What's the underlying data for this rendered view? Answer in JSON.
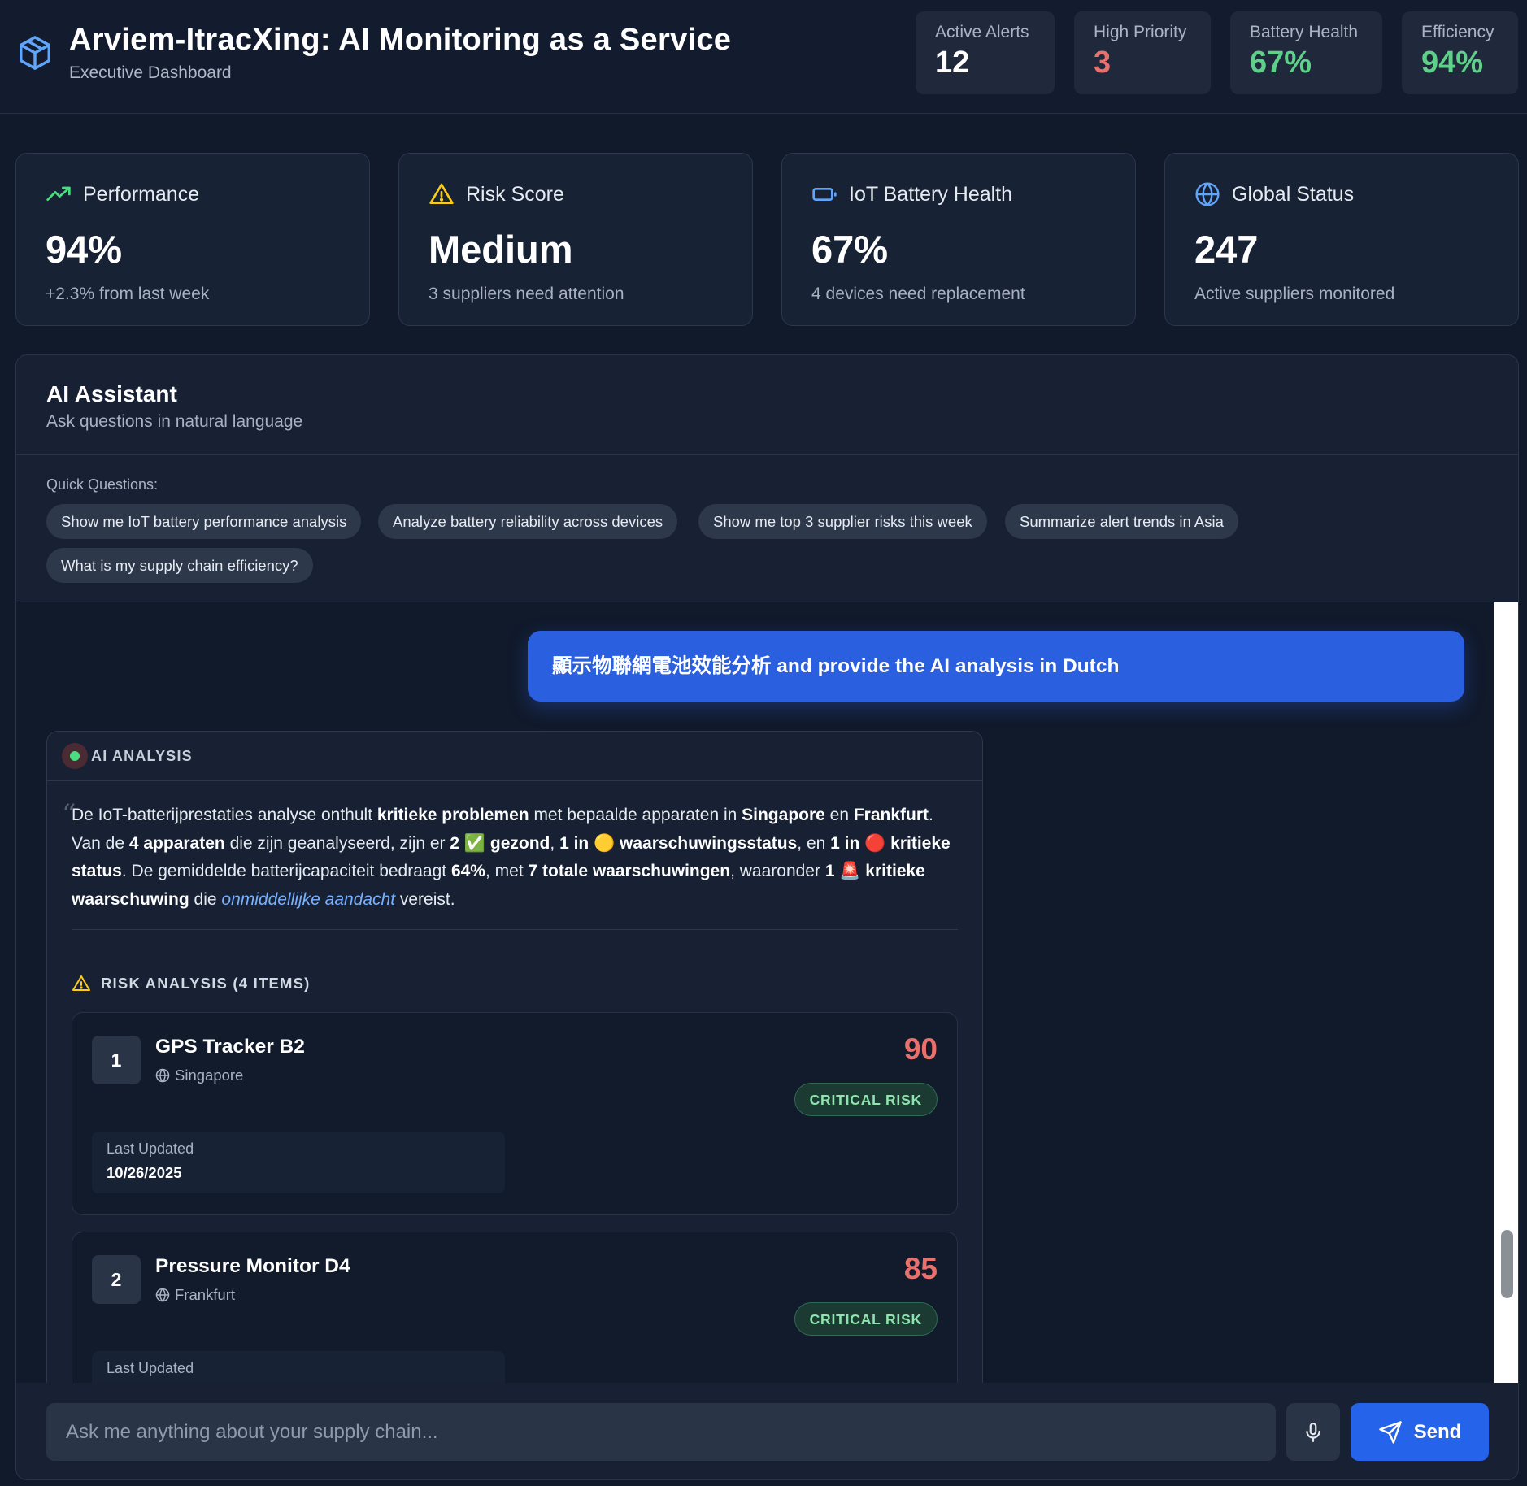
{
  "header": {
    "title": "Arviem-ItracXing: AI Monitoring as a Service",
    "subtitle": "Executive Dashboard",
    "icon": "package-cube-icon",
    "stats": [
      {
        "label": "Active Alerts",
        "value": "12",
        "color": "#ffffff"
      },
      {
        "label": "High Priority",
        "value": "3",
        "color": "#e8716d"
      },
      {
        "label": "Battery Health",
        "value": "67%",
        "color": "#5fd08a"
      },
      {
        "label": "Efficiency",
        "value": "94%",
        "color": "#5fd08a"
      }
    ]
  },
  "kpis": [
    {
      "title": "Performance",
      "value": "94%",
      "sub": "+2.3% from last week",
      "icon": "trending-up-icon",
      "color": "#4ade80"
    },
    {
      "title": "Risk Score",
      "value": "Medium",
      "sub": "3 suppliers need attention",
      "icon": "warning-triangle-icon",
      "color": "#facc15"
    },
    {
      "title": "IoT Battery Health",
      "value": "67%",
      "sub": "4 devices need replacement",
      "icon": "battery-icon",
      "color": "#60a5fa"
    },
    {
      "title": "Global Status",
      "value": "247",
      "sub": "Active suppliers monitored",
      "icon": "globe-icon",
      "color": "#60a5fa"
    }
  ],
  "assistant": {
    "title": "AI Assistant",
    "subtitle": "Ask questions in natural language",
    "quick_label": "Quick Questions:",
    "quick_questions": [
      "Show me IoT battery performance analysis",
      "Analyze battery reliability across devices",
      "Show me top 3 supplier risks this week",
      "Summarize alert trends in Asia",
      "What is my supply chain efficiency?"
    ],
    "user_message": "顯示物聯網電池效能分析 and provide the AI analysis in Dutch",
    "ai_label": "AI ANALYSIS",
    "analysis_paragraph": "De IoT-batterijprestaties analyse onthult kritieke problemen met bepaalde apparaten in Singapore en Frankfurt. Van de 4 apparaten die zijn geanalyseerd, zijn er 2 ✅ gezond, 1 in 🟡 waarschuwingsstatus, en 1 in 🔴 kritieke status. De gemiddelde batterijcapaciteit bedraagt 64%, met 7 totale waarschuwingen, waaronder 1 🚨 kritieke waarschuwing die onmiddellijke aandacht vereist.",
    "analysis_parts": {
      "p1": "De IoT-batterijprestaties analyse onthult ",
      "b1": "kritieke problemen",
      "p2": " met bepaalde apparaten in ",
      "b2": "Singapore",
      "p3": " en ",
      "b3": "Frankfurt",
      "p4": ". Van de ",
      "b4": "4 apparaten",
      "p5": " die zijn geanalyseerd, zijn er ",
      "b5": "2 ✅ gezond",
      "p6": ", ",
      "b6": "1 in 🟡 waarschuwingsstatus",
      "p7": ", en ",
      "b7": "1 in 🔴 kritieke status",
      "p8": ". De gemiddelde batterijcapaciteit bedraagt ",
      "b8": "64%",
      "p9": ", met ",
      "b9": "7 totale waarschuwingen",
      "p10": ", waaronder ",
      "b10": "1 🚨 kritieke waarschuwing",
      "p11": " die ",
      "i1": "onmiddellijke aandacht",
      "p12": " vereist."
    },
    "risk_title": "RISK ANALYSIS (4 ITEMS)",
    "risk_items": [
      {
        "rank": "1",
        "name": "GPS Tracker B2",
        "location": "Singapore",
        "score": "90",
        "badge": "CRITICAL RISK",
        "updated_label": "Last Updated",
        "updated_value": "10/26/2025"
      },
      {
        "rank": "2",
        "name": "Pressure Monitor D4",
        "location": "Frankfurt",
        "score": "85",
        "badge": "CRITICAL RISK",
        "updated_label": "Last Updated",
        "updated_value": ""
      }
    ],
    "input_placeholder": "Ask me anything about your supply chain...",
    "send_label": "Send"
  }
}
